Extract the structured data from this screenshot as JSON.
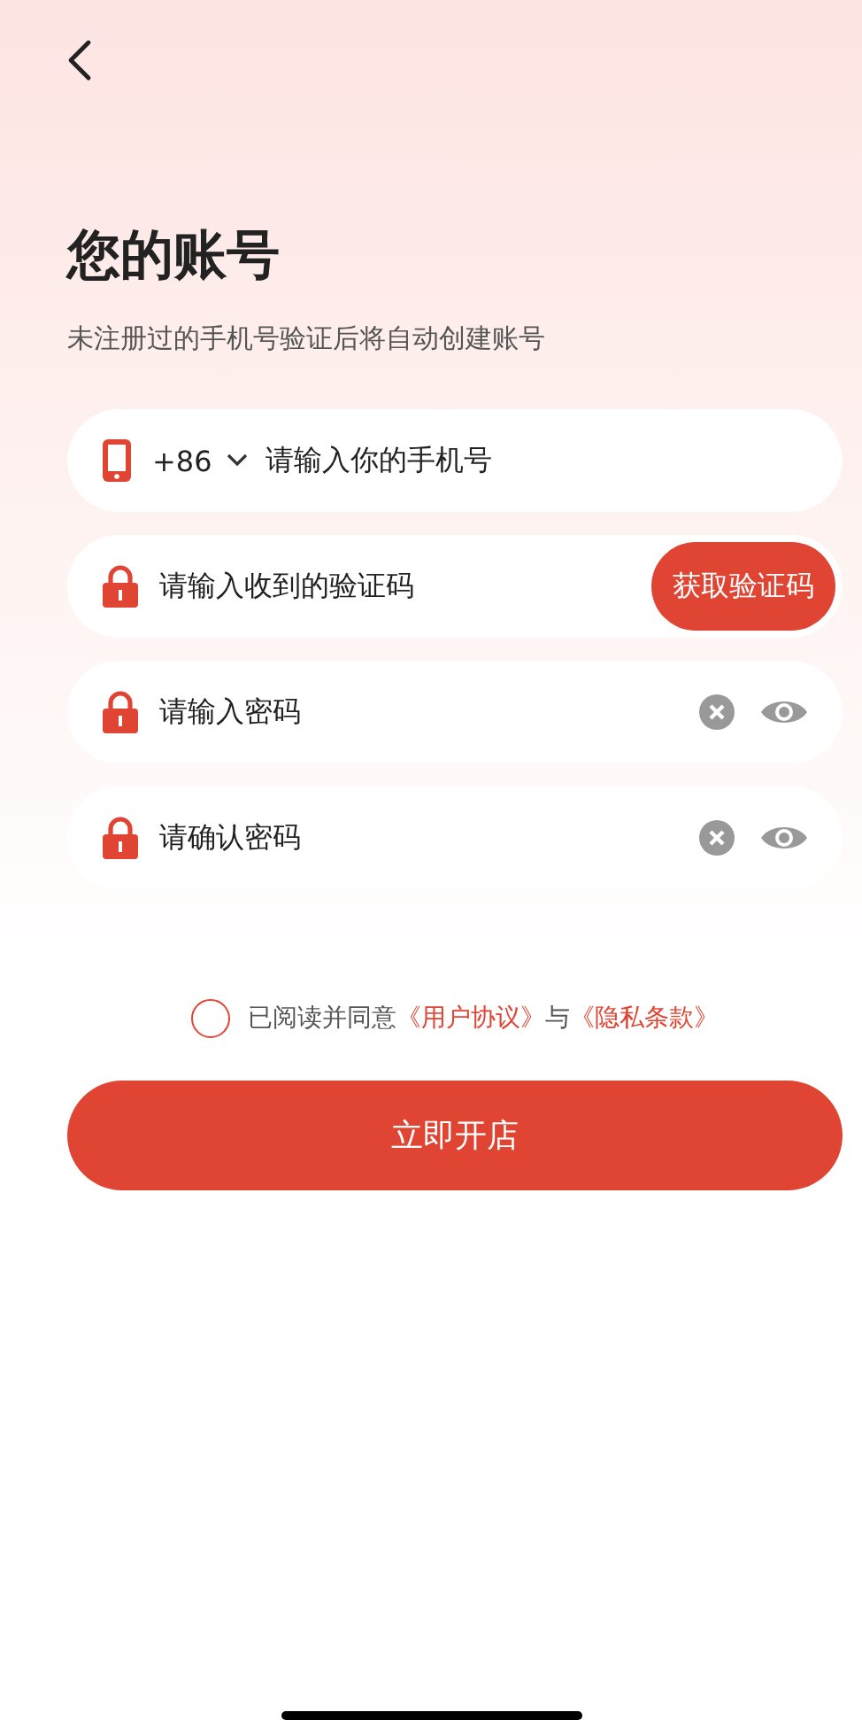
{
  "title": "您的账号",
  "subtitle": "未注册过的手机号验证后将自动创建账号",
  "fields": [
    {
      "kind": "phone",
      "country_code": "+86",
      "placeholder": "请输入你的手机号"
    },
    {
      "kind": "code",
      "placeholder": "请输入收到的验证码",
      "button": "获取验证码"
    },
    {
      "kind": "password",
      "placeholder": "请输入密码"
    },
    {
      "kind": "password",
      "placeholder": "请确认密码"
    }
  ],
  "agreement": {
    "checked": false,
    "text": "已阅读并同意",
    "link_1": "《用户协议》",
    "joiner": "与",
    "link_2": "《隐私条款》"
  },
  "submit": "立即开店"
}
